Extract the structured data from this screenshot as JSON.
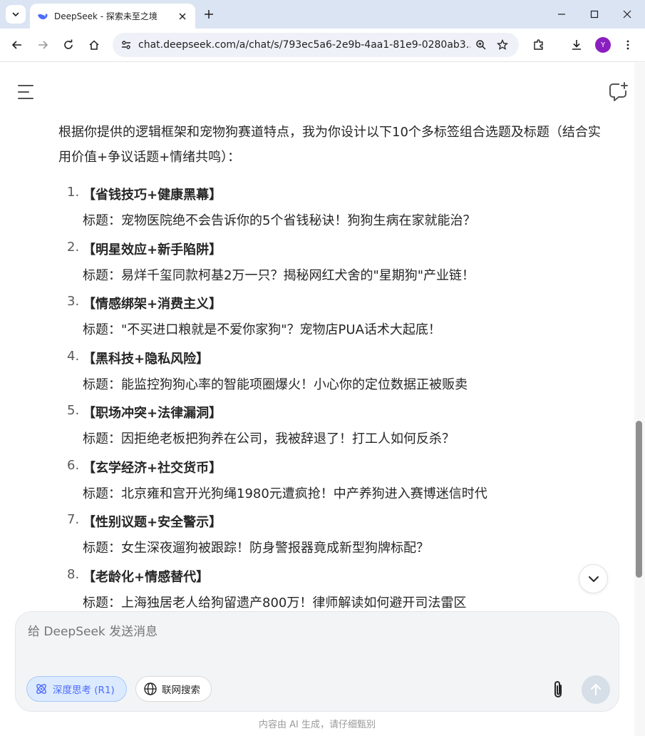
{
  "browser": {
    "tab_title": "DeepSeek - 探索未至之境",
    "url": "chat.deepseek.com/a/chat/s/793ec5a6-2e9b-4aa1-81e9-0280ab3...",
    "profile_initial": "Y"
  },
  "chat": {
    "intro": "根据你提供的逻辑框架和宠物狗赛道特点，我为你设计以下10个多标签组合选题及标题（结合实用价值+争议话题+情绪共鸣）：",
    "items": [
      {
        "num": "1.",
        "head": "【省钱技巧+健康黑幕】",
        "sub": "标题：宠物医院绝不会告诉你的5个省钱秘诀！狗狗生病在家就能治？"
      },
      {
        "num": "2.",
        "head": "【明星效应+新手陷阱】",
        "sub": "标题：易烊千玺同款柯基2万一只？揭秘网红犬舍的\"星期狗\"产业链！"
      },
      {
        "num": "3.",
        "head": "【情感绑架+消费主义】",
        "sub": "标题：\"不买进口粮就是不爱你家狗\"？宠物店PUA话术大起底！"
      },
      {
        "num": "4.",
        "head": "【黑科技+隐私风险】",
        "sub": "标题：能监控狗狗心率的智能项圈爆火！小心你的定位数据正被贩卖"
      },
      {
        "num": "5.",
        "head": "【职场冲突+法律漏洞】",
        "sub": "标题：因拒绝老板把狗养在公司，我被辞退了！打工人如何反杀？"
      },
      {
        "num": "6.",
        "head": "【玄学经济+社交货币】",
        "sub": "标题：北京雍和宫开光狗绳1980元遭疯抢！中产养狗进入赛博迷信时代"
      },
      {
        "num": "7.",
        "head": "【性别议题+安全警示】",
        "sub": "标题：女生深夜遛狗被跟踪！防身警报器竟成新型狗牌标配？"
      },
      {
        "num": "8.",
        "head": "【老龄化+情感替代】",
        "sub": "标题：上海独居老人给狗留遗产800万！律师解读如何避开司法雷区"
      }
    ]
  },
  "composer": {
    "placeholder": "给 DeepSeek 发送消息",
    "deep_think_label": "深度思考 (R1)",
    "web_search_label": "联网搜索"
  },
  "footer": {
    "disclaimer": "内容由 AI 生成，请仔细甄别"
  },
  "colors": {
    "accent": "#4d6bfe",
    "tabbar_bg": "#dbe4f3",
    "profile": "#8a1fbf"
  }
}
